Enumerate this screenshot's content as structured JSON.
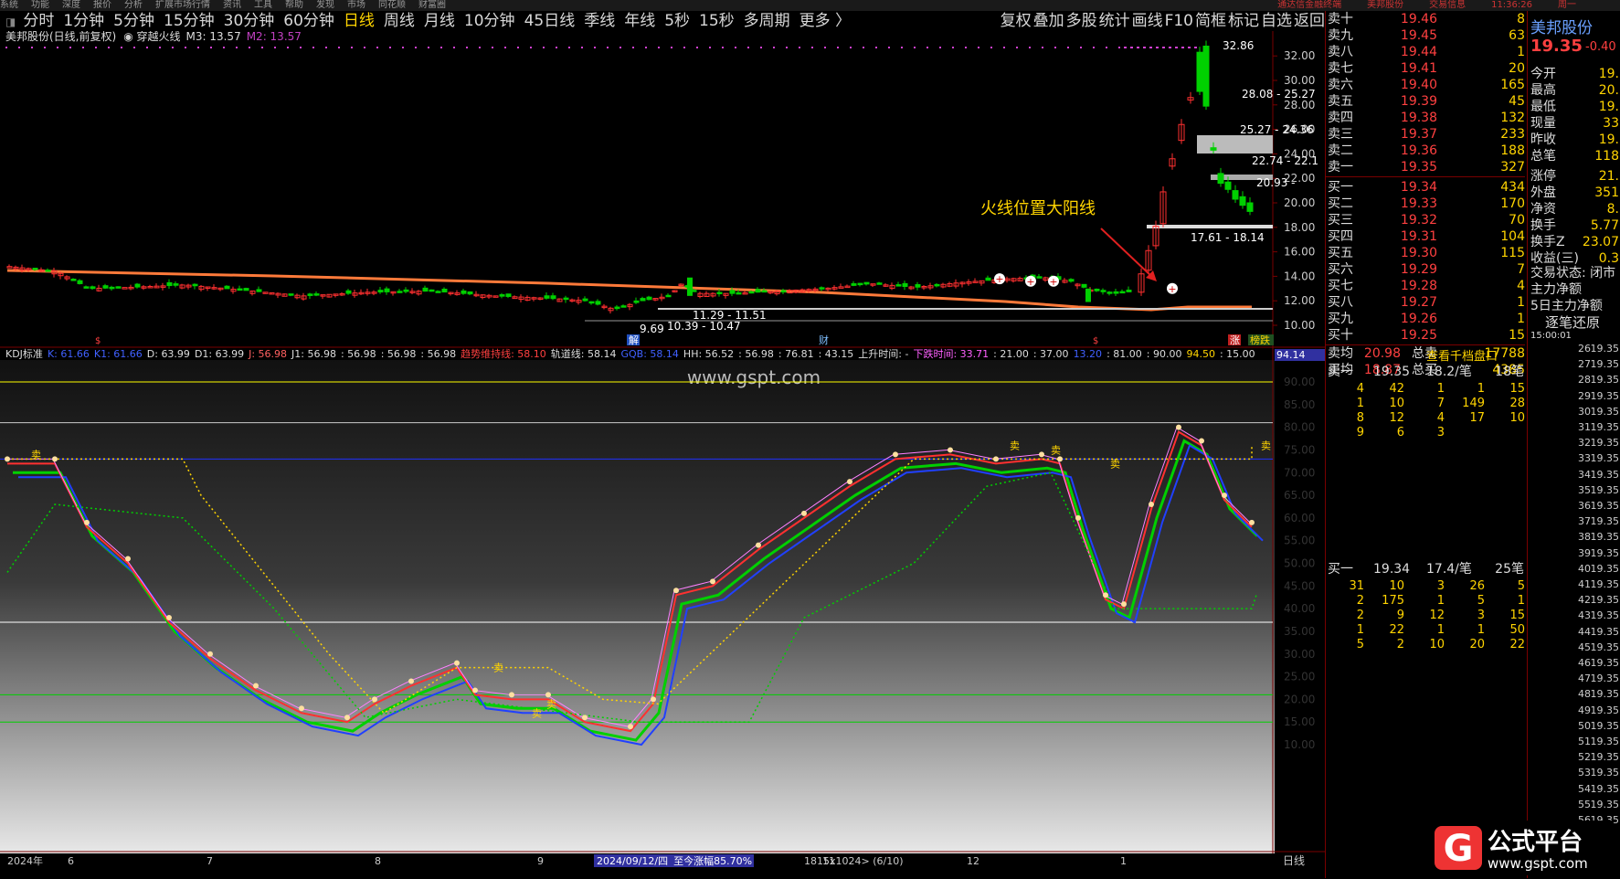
{
  "menu": [
    "系统",
    "功能",
    "深度",
    "报价",
    "分析",
    "扩展市场行情",
    "资讯",
    "工具",
    "帮助",
    "发现",
    "市场",
    "同花顺",
    "财富圈"
  ],
  "menu_right": [
    "通达信金融终端",
    "美邦股份",
    "交易信息",
    "11:36:26",
    "周一"
  ],
  "periods": [
    "分时",
    "1分钟",
    "5分钟",
    "15分钟",
    "30分钟",
    "60分钟",
    "日线",
    "周线",
    "月线",
    "10分钟",
    "45日线",
    "季线",
    "年线",
    "5秒",
    "15秒",
    "多周期",
    "更多 〉"
  ],
  "active_period": "日线",
  "toolbar_right": [
    "复权",
    "叠加",
    "多股",
    "统计",
    "画线",
    "F10",
    "简框",
    "标记",
    "自选",
    "返回"
  ],
  "main_header": {
    "title": "美邦股份(日线,前复权)",
    "indicator": "穿越火线",
    "m3": "M3: 13.57",
    "m2": "M2: 13.57"
  },
  "annotation": "火线位置大阳线",
  "price_labels": [
    "32.86",
    "28.08 - 25.27",
    "25.27 - 24.36",
    "22.74 - 22.1",
    "20.93 -",
    "17.61 - 18.14",
    "11.29 - 11.51",
    "10.39 - 10.47",
    "9.69"
  ],
  "markers": {
    "jie": "解",
    "cai": "财",
    "zhang": "涨",
    "bangdie": "榜跌"
  },
  "kdj_header": {
    "name": "KDJ标准",
    "k": "K: 61.66",
    "k1": "K1: 61.66",
    "d": "D: 63.99",
    "d1": "D1: 63.99",
    "j": "J: 56.98",
    "j1": "J1: 56.98",
    "v1": ": 56.98",
    "v2": ": 56.98",
    "v3": ": 56.98",
    "trend": "趋势维持线: 58.10",
    "track": "轨道线: 58.14",
    "gray": "GQB: 58.14",
    "hh": "HH: 56.52",
    "v4": ": 56.98",
    "v5": ": 76.81",
    "v6": ": 43.15",
    "up": "上升时间: -",
    "down": "下跌时间: 33.71",
    "v7": ": 21.00",
    "v8": ": 37.00",
    "v9": "13.20",
    "v10": ": 81.00",
    "v11": ": 90.00",
    "v12": "94.50",
    "v13": ": 15.00",
    "last": "94.14"
  },
  "watermark": "www.gspt.com",
  "kdj_ticks": [
    "90.00",
    "85.00",
    "80.00",
    "75.00",
    "70.00",
    "65.00",
    "60.00",
    "55.00",
    "50.00",
    "45.00",
    "40.00",
    "35.00",
    "30.00",
    "25.00",
    "20.00",
    "15.00",
    "10.00"
  ],
  "price_ticks": [
    "32.00",
    "30.00",
    "28.00",
    "26.00",
    "24.00",
    "22.00",
    "20.00",
    "18.00",
    "16.00",
    "14.00",
    "12.00",
    "10.00"
  ],
  "sell_labels": [
    "卖",
    "卖",
    "卖",
    "卖",
    "卖",
    "卖",
    "卖",
    "卖"
  ],
  "bottom_axis": {
    "year": "2024年",
    "months": [
      "6",
      "7",
      "8",
      "9",
      "10",
      "11",
      "12",
      "1"
    ],
    "date": "2024/09/12/四",
    "rise": "至今涨幅85.70%",
    "size": "1815x1024> (6/10)",
    "daily": "日线"
  },
  "order_book": {
    "sell": [
      [
        "卖十",
        "19.46",
        "8"
      ],
      [
        "卖九",
        "19.45",
        "63"
      ],
      [
        "卖八",
        "19.44",
        "1"
      ],
      [
        "卖七",
        "19.41",
        "20"
      ],
      [
        "卖六",
        "19.40",
        "165"
      ],
      [
        "卖五",
        "19.39",
        "45"
      ],
      [
        "卖四",
        "19.38",
        "132"
      ],
      [
        "卖三",
        "19.37",
        "233"
      ],
      [
        "卖二",
        "19.36",
        "188"
      ],
      [
        "卖一",
        "19.35",
        "327"
      ]
    ],
    "buy": [
      [
        "买一",
        "19.34",
        "434"
      ],
      [
        "买二",
        "19.33",
        "170"
      ],
      [
        "买三",
        "19.32",
        "70"
      ],
      [
        "买四",
        "19.31",
        "104"
      ],
      [
        "买五",
        "19.30",
        "115"
      ],
      [
        "买六",
        "19.29",
        "7"
      ],
      [
        "买七",
        "19.28",
        "4"
      ],
      [
        "买八",
        "19.27",
        "1"
      ],
      [
        "买九",
        "19.26",
        "1"
      ],
      [
        "买十",
        "19.25",
        "15"
      ]
    ],
    "sell_avg": [
      "卖均",
      "20.98",
      "总卖",
      "17788"
    ],
    "buy_avg": [
      "买均",
      "18.87",
      "总买",
      "4385"
    ]
  },
  "stock": {
    "name": "美邦股份",
    "price": "19.35",
    "change": "-0.40"
  },
  "stats": [
    [
      "今开",
      "19."
    ],
    [
      "最高",
      "20."
    ],
    [
      "最低",
      "19."
    ],
    [
      "现量",
      "33"
    ],
    [
      "昨收",
      "19."
    ],
    [
      "总笔",
      "118"
    ],
    [
      "涨停",
      "21."
    ],
    [
      "外盘",
      "351"
    ],
    [
      "净资",
      "8."
    ],
    [
      "换手",
      "5.77"
    ],
    [
      "换手Z",
      "23.07"
    ],
    [
      "收益(三)",
      "0.3"
    ]
  ],
  "trade_status": "交易状态: 闭市",
  "main_net": "主力净额",
  "main_net5": "5日主力净额",
  "tick_restore": "逐笔还原",
  "tick_time": "15:00:01",
  "detail_button": "查看千档盘口",
  "queue_sell": {
    "label": "卖一",
    "price": "19.35",
    "per": "18.2/笔",
    "count": "18笔",
    "rows": [
      [
        "4",
        "42",
        "1",
        "1",
        "15"
      ],
      [
        "1",
        "10",
        "7",
        "149",
        "28"
      ],
      [
        "8",
        "12",
        "4",
        "17",
        "10"
      ],
      [
        "9",
        "6",
        "3",
        "",
        ""
      ]
    ]
  },
  "queue_buy": {
    "label": "买一",
    "price": "19.34",
    "per": "17.4/笔",
    "count": "25笔",
    "rows": [
      [
        "31",
        "10",
        "3",
        "26",
        "5"
      ],
      [
        "2",
        "175",
        "1",
        "5",
        "1"
      ],
      [
        "2",
        "9",
        "12",
        "3",
        "15"
      ],
      [
        "1",
        "22",
        "1",
        "1",
        "50"
      ],
      [
        "5",
        "2",
        "10",
        "20",
        "22"
      ]
    ]
  },
  "ticks": [
    [
      "26",
      "19.35"
    ],
    [
      "27",
      "19.35"
    ],
    [
      "28",
      "19.35"
    ],
    [
      "29",
      "19.35"
    ],
    [
      "30",
      "19.35"
    ],
    [
      "31",
      "19.35"
    ],
    [
      "32",
      "19.35"
    ],
    [
      "33",
      "19.35"
    ],
    [
      "34",
      "19.35"
    ],
    [
      "35",
      "19.35"
    ],
    [
      "36",
      "19.35"
    ],
    [
      "37",
      "19.35"
    ],
    [
      "38",
      "19.35"
    ],
    [
      "39",
      "19.35"
    ],
    [
      "40",
      "19.35"
    ],
    [
      "41",
      "19.35"
    ],
    [
      "42",
      "19.35"
    ],
    [
      "43",
      "19.35"
    ],
    [
      "44",
      "19.35"
    ],
    [
      "45",
      "19.35"
    ],
    [
      "46",
      "19.35"
    ],
    [
      "47",
      "19.35"
    ],
    [
      "48",
      "19.35"
    ],
    [
      "49",
      "19.35"
    ],
    [
      "50",
      "19.35"
    ],
    [
      "51",
      "19.35"
    ],
    [
      "52",
      "19.35"
    ],
    [
      "53",
      "19.35"
    ],
    [
      "54",
      "19.35"
    ],
    [
      "55",
      "19.35"
    ],
    [
      "56",
      "19.35"
    ]
  ],
  "logo_text": "公式平台",
  "logo_url": "www.gspt.com",
  "colors": {
    "up": "#ff3030",
    "down": "#00d000",
    "yellow": "#ffd400",
    "fire": "#ff7a3a",
    "blue": "#2040ff",
    "bg": "#000000"
  }
}
